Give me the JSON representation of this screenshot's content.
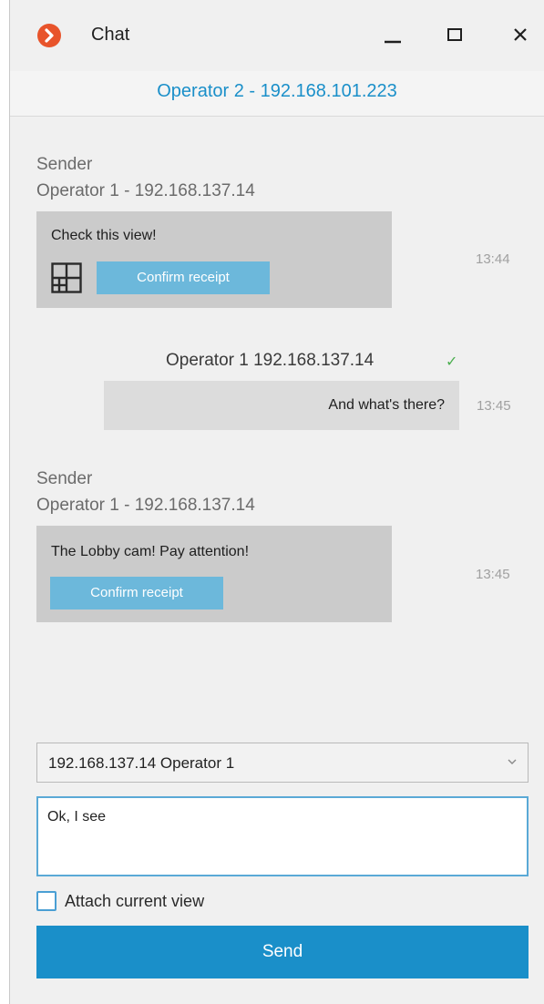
{
  "window": {
    "title": "Chat",
    "accent": "#1a8fc9",
    "logo_color": "#e8542b"
  },
  "header": {
    "contact": "Operator 2 - 192.168.101.223"
  },
  "messages": [
    {
      "direction": "incoming",
      "sender_caption": "Sender",
      "sender": "Operator 1 - 192.168.137.14",
      "text": "Check this view!",
      "has_view_icon": true,
      "view_icon": "layout-grid-icon",
      "action": "Confirm receipt",
      "time": "13:44"
    },
    {
      "direction": "outgoing",
      "sender": "Operator 1 192.168.137.14",
      "status_icon": "check-icon",
      "text": "And what's there?",
      "time": "13:45"
    },
    {
      "direction": "incoming",
      "sender_caption": "Sender",
      "sender": "Operator 1 - 192.168.137.14",
      "text": "The Lobby cam! Pay attention!",
      "action": "Confirm receipt",
      "time": "13:45"
    }
  ],
  "composer": {
    "recipient": "192.168.137.14 Operator 1",
    "message_value": "Ok, I see",
    "attach_label": "Attach current view",
    "attach_checked": false,
    "send_label": "Send"
  }
}
